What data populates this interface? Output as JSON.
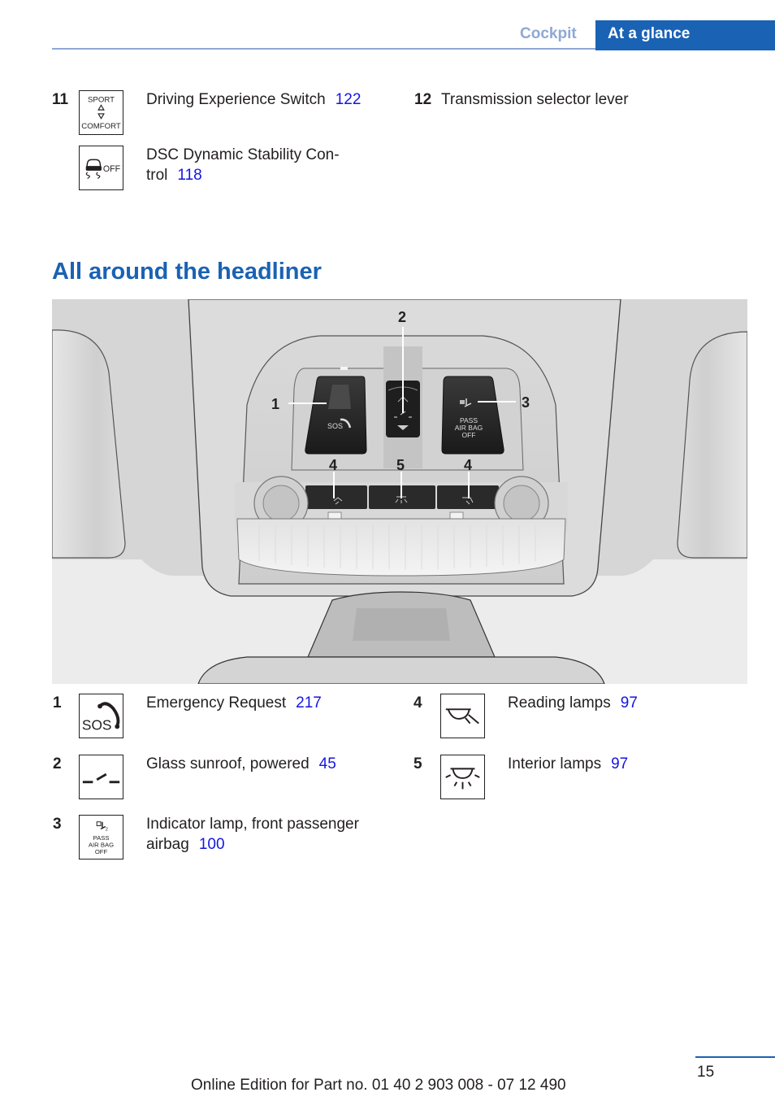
{
  "header": {
    "section": "Cockpit",
    "chapter": "At a glance"
  },
  "top_items": [
    {
      "number": "11",
      "entries": [
        {
          "label": "Driving Experience Switch",
          "page_ref": "122",
          "icon": "driving-experience-switch-icon",
          "icon_text": [
            "SPORT",
            "COMFORT"
          ]
        },
        {
          "label_lines": [
            "DSC Dynamic Stability Con-",
            "trol"
          ],
          "page_ref": "118",
          "icon": "dsc-off-icon",
          "icon_text": [
            "OFF"
          ]
        }
      ]
    },
    {
      "number": "12",
      "entries": [
        {
          "label": "Transmission selector lever"
        }
      ]
    }
  ],
  "section_title": "All around the headliner",
  "illustration": {
    "callouts": [
      "1",
      "2",
      "3",
      "4",
      "5",
      "4"
    ],
    "button_texts": {
      "sos": "SOS",
      "airbag": [
        "PASS",
        "AIR BAG",
        "OFF"
      ]
    }
  },
  "legend_left": [
    {
      "number": "1",
      "label": "Emergency Request",
      "page_ref": "217",
      "icon": "sos-icon",
      "icon_text": "SOS"
    },
    {
      "number": "2",
      "label": "Glass sunroof, powered",
      "page_ref": "45",
      "icon": "sunroof-icon"
    },
    {
      "number": "3",
      "label_lines": [
        "Indicator lamp, front passenger",
        "airbag"
      ],
      "page_ref": "100",
      "icon": "passenger-airbag-off-icon",
      "icon_text": [
        "PASS",
        "AIR BAG",
        "OFF"
      ]
    }
  ],
  "legend_right": [
    {
      "number": "4",
      "label": "Reading lamps",
      "page_ref": "97",
      "icon": "reading-lamp-icon"
    },
    {
      "number": "5",
      "label": "Interior lamps",
      "page_ref": "97",
      "icon": "interior-lamp-icon"
    }
  ],
  "footer": {
    "page_number": "15",
    "edition": "Online Edition for Part no. 01 40 2 903 008 - 07 12 490"
  },
  "colors": {
    "brand_blue": "#1a62b4",
    "light_blue": "#8fa8d4",
    "link_blue": "#1515e0"
  }
}
